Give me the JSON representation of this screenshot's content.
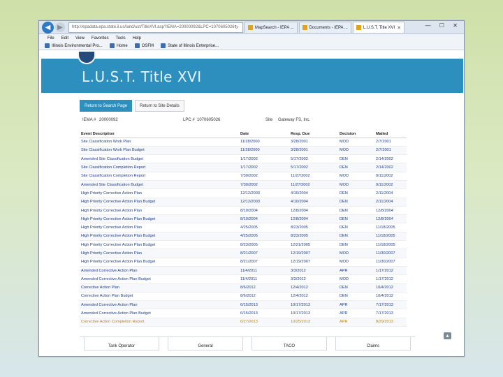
{
  "browser": {
    "address": "http://epadata.epa.state.il.us/land/ust/TitleXVI.asp?IEMA=20000092&LPC=1070605026",
    "tabs": [
      {
        "label": "MapSearch - IEPA ...",
        "active": false
      },
      {
        "label": "Documents - IEPA ...",
        "active": false
      },
      {
        "label": "L.U.S.T. Title XVI",
        "active": true
      }
    ],
    "window_controls": "— ☐ ✕",
    "menu": [
      "File",
      "Edit",
      "View",
      "Favorites",
      "Tools",
      "Help"
    ],
    "favorites": [
      {
        "label": "Illinois Environmental Pro...",
        "icon": "ie-page-icon"
      },
      {
        "label": "Home",
        "icon": "ie-page-icon"
      },
      {
        "label": "OSFM",
        "icon": "ie-page-icon"
      },
      {
        "label": "State of Illinois Enterprise...",
        "icon": "ie-page-icon"
      }
    ]
  },
  "page": {
    "title": "L.U.S.T. Title XVI",
    "buttons": {
      "return_search": "Return to Search Page",
      "return_site": "Return to Site Details"
    },
    "info": {
      "iema_label": "IEMA #",
      "iema_value": "20000092",
      "lpc_label": "LPC #",
      "lpc_value": "1070605026",
      "site_label": "Site",
      "site_value": "Gateway FS, Inc."
    },
    "table": {
      "headers": [
        "Event Description",
        "Date",
        "Resp. Due",
        "Decision",
        "Mailed"
      ],
      "rows": [
        [
          "Site Classification Work Plan",
          "11/28/2000",
          "3/28/2001",
          "MOD",
          "2/7/2001"
        ],
        [
          "Site Classification Work Plan Budget",
          "11/28/2000",
          "3/28/2001",
          "MOD",
          "2/7/2001"
        ],
        [
          "Amended Site Classification Budget",
          "1/17/2002",
          "5/17/2002",
          "DEN",
          "2/14/2002"
        ],
        [
          "Site Classification Completion Report",
          "1/17/2002",
          "5/17/2002",
          "DEN",
          "2/14/2002"
        ],
        [
          "Site Classification Completion Report",
          "7/30/2002",
          "11/27/2002",
          "MOD",
          "9/11/2002"
        ],
        [
          "Amended Site Classification Budget",
          "7/30/2002",
          "11/27/2002",
          "MOD",
          "9/11/2002"
        ],
        [
          "High Priority Corrective Action Plan",
          "12/12/2003",
          "4/10/2004",
          "DEN",
          "2/11/2004"
        ],
        [
          "High Priority Corrective Action Plan Budget",
          "12/12/2003",
          "4/10/2004",
          "DEN",
          "2/11/2004"
        ],
        [
          "High Priority Corrective Action Plan",
          "8/10/2004",
          "12/8/2004",
          "DEN",
          "12/8/2004"
        ],
        [
          "High Priority Corrective Action Plan Budget",
          "8/10/2004",
          "12/8/2004",
          "DEN",
          "12/8/2004"
        ],
        [
          "High Priority Corrective Action Plan",
          "4/25/2005",
          "8/23/2005",
          "DEN",
          "11/18/2005"
        ],
        [
          "High Priority Corrective Action Plan Budget",
          "4/25/2005",
          "8/23/2005",
          "DEN",
          "11/18/2005"
        ],
        [
          "High Priority Corrective Action Plan Budget",
          "8/23/2005",
          "12/21/2005",
          "DEN",
          "11/18/2005"
        ],
        [
          "High Priority Corrective Action Plan",
          "8/21/2007",
          "12/19/2007",
          "MOD",
          "11/30/2007"
        ],
        [
          "High Priority Corrective Action Plan Budget",
          "8/21/2007",
          "12/19/2007",
          "MOD",
          "11/30/2007"
        ],
        [
          "Amended Corrective Action Plan",
          "11/4/2011",
          "3/3/2012",
          "APR",
          "1/17/2012"
        ],
        [
          "Amended Corrective Action Plan Budget",
          "11/4/2011",
          "3/3/2012",
          "MOD",
          "1/17/2012"
        ],
        [
          "Corrective Action Plan",
          "8/6/2012",
          "12/4/2012",
          "DEN",
          "10/4/2012"
        ],
        [
          "Corrective Action Plan Budget",
          "8/6/2012",
          "12/4/2012",
          "DEN",
          "10/4/2012"
        ],
        [
          "Amended Corrective Action Plan",
          "6/15/2013",
          "10/17/2013",
          "APR",
          "7/17/2013"
        ],
        [
          "Amended Corrective Action Plan Budget",
          "6/15/2013",
          "10/17/2013",
          "APR",
          "7/17/2013"
        ],
        [
          "Corrective Action Completion Report",
          "6/27/2013",
          "10/25/2013",
          "APR",
          "8/29/2013"
        ]
      ],
      "highlighted_row": 21
    },
    "bottom_tabs": [
      "Tank Operator",
      "General",
      "TACO",
      "Claims"
    ]
  },
  "colors": {
    "banner": "#2c8fbe",
    "highlight": "#fbf7a8",
    "link": "#1f3f8a"
  }
}
